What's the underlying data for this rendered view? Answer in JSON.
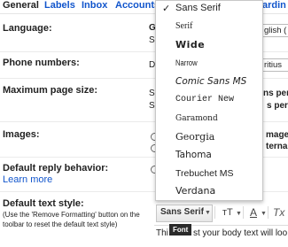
{
  "tabs": [
    "General",
    "Labels",
    "Inbox",
    "Accounts",
    "ardin"
  ],
  "settings": {
    "language_label": "Language:",
    "phone_label": "Phone numbers:",
    "page_size_label": "Maximum page size:",
    "images_label": "Images:",
    "reply_label": "Default reply behavior:",
    "reply_link": "Learn more",
    "text_style_label": "Default text style:",
    "text_style_note_1": "(Use the 'Remove Formatting' button on the",
    "text_style_note_2": "toolbar to reset the default text style)"
  },
  "background_peek": {
    "language_g": "G",
    "language_s": "S",
    "language_box": "glish (",
    "phone_d": "D",
    "phone_box": "ritius",
    "page_s": "S",
    "page_text_1": "ns per",
    "page_text_2": "s per",
    "images_text_1": "mage",
    "images_text_2": "ternal",
    "editor_t": "Thi",
    "editor_text": "st your body text will loo"
  },
  "font_menu": {
    "selected": "Sans Serif",
    "items": [
      "Sans Serif",
      "Serif",
      "Wide",
      "Narrow",
      "Comic Sans MS",
      "Courier New",
      "Garamond",
      "Georgia",
      "Tahoma",
      "Trebuchet MS",
      "Verdana"
    ]
  },
  "toolbar": {
    "font_label": "Sans Serif",
    "size_label": "тT",
    "color_label": "A",
    "remove_format_label": "Tx",
    "tooltip": "Font"
  }
}
